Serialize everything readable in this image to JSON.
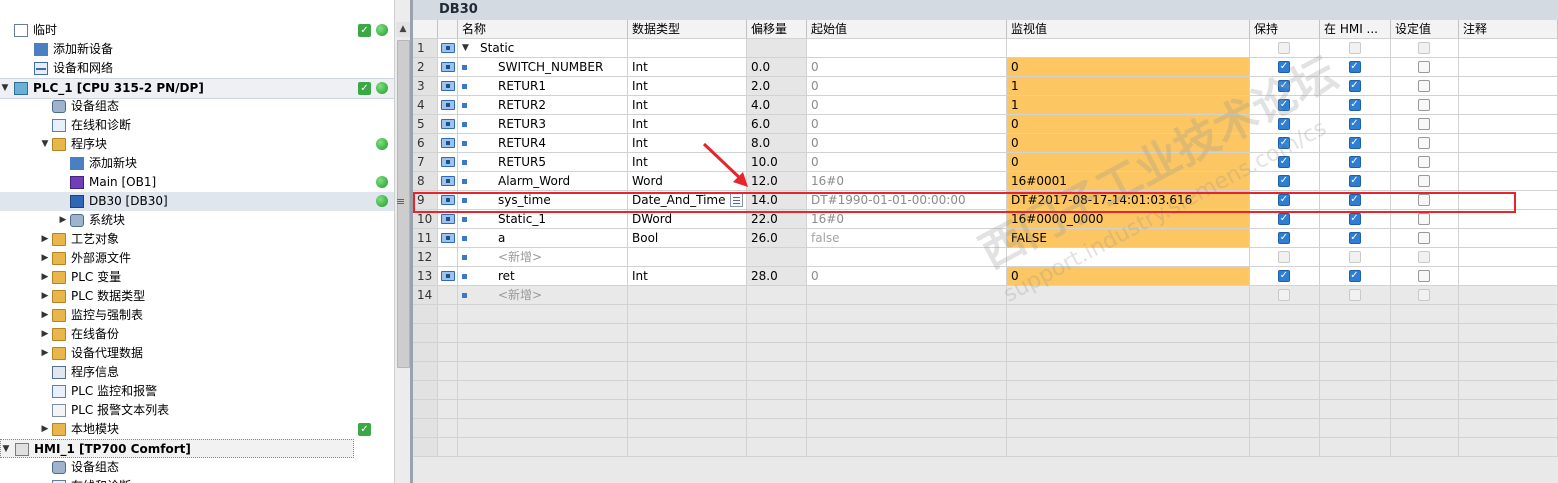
{
  "tree": {
    "items": [
      {
        "label": "临时",
        "indent": 0,
        "icon": "document-icon",
        "checkbox": true,
        "status_dot": true
      },
      {
        "label": "添加新设备",
        "indent": 1,
        "icon": "add-device-icon"
      },
      {
        "label": "设备和网络",
        "indent": 1,
        "icon": "network-icon"
      },
      {
        "label": "PLC_1 [CPU 315-2 PN/DP]",
        "indent": 0,
        "icon": "plc-icon",
        "bold": true,
        "expanded": true,
        "checkbox": true,
        "status_dot": true
      },
      {
        "label": "设备组态",
        "indent": 2,
        "icon": "device-config-icon"
      },
      {
        "label": "在线和诊断",
        "indent": 2,
        "icon": "diagnostics-icon"
      },
      {
        "label": "程序块",
        "indent": 2,
        "icon": "folder-icon",
        "expanded": true,
        "status_dot": true
      },
      {
        "label": "添加新块",
        "indent": 3,
        "icon": "add-block-icon"
      },
      {
        "label": "Main [OB1]",
        "indent": 3,
        "icon": "ob-block-icon",
        "status_dot": true
      },
      {
        "label": "DB30 [DB30]",
        "indent": 3,
        "icon": "db-block-icon",
        "status_dot": true,
        "selected": true
      },
      {
        "label": "系统块",
        "indent": 3,
        "icon": "system-block-icon",
        "collapsed": true
      },
      {
        "label": "工艺对象",
        "indent": 2,
        "icon": "folder-icon",
        "collapsed": true
      },
      {
        "label": "外部源文件",
        "indent": 2,
        "icon": "folder-icon",
        "collapsed": true
      },
      {
        "label": "PLC 变量",
        "indent": 2,
        "icon": "folder-icon",
        "collapsed": true
      },
      {
        "label": "PLC 数据类型",
        "indent": 2,
        "icon": "folder-icon",
        "collapsed": true
      },
      {
        "label": "监控与强制表",
        "indent": 2,
        "icon": "folder-icon",
        "collapsed": true
      },
      {
        "label": "在线备份",
        "indent": 2,
        "icon": "folder-icon",
        "collapsed": true
      },
      {
        "label": "设备代理数据",
        "indent": 2,
        "icon": "folder-icon",
        "collapsed": true
      },
      {
        "label": "程序信息",
        "indent": 2,
        "icon": "program-info-icon"
      },
      {
        "label": "PLC 监控和报警",
        "indent": 2,
        "icon": "alarm-icon"
      },
      {
        "label": "PLC 报警文本列表",
        "indent": 2,
        "icon": "text-list-icon"
      },
      {
        "label": "本地模块",
        "indent": 2,
        "icon": "folder-icon",
        "collapsed": true,
        "checkbox": true
      },
      {
        "label": "HMI_1 [TP700 Comfort]",
        "indent": 0,
        "icon": "hmi-icon",
        "bold": true,
        "expanded": true,
        "device_dotted": true
      },
      {
        "label": "设备组态",
        "indent": 2,
        "icon": "device-config-icon"
      },
      {
        "label": "在线和诊断",
        "indent": 2,
        "icon": "diagnostics-icon"
      }
    ]
  },
  "db": {
    "title": "DB30",
    "columns": [
      "名称",
      "数据类型",
      "偏移量",
      "起始值",
      "监视值",
      "保持",
      "在 HMI ...",
      "设定值",
      "注释"
    ],
    "rows": [
      {
        "num": "1",
        "name": "Static",
        "type": "",
        "offset": "",
        "start": "",
        "monitor": "",
        "retain": false,
        "hmi": false,
        "setpoint": false,
        "is_section": true
      },
      {
        "num": "2",
        "name": "SWITCH_NUMBER",
        "type": "Int",
        "offset": "0.0",
        "start": "0",
        "monitor": "0",
        "retain": true,
        "hmi": true,
        "setpoint": false
      },
      {
        "num": "3",
        "name": "RETUR1",
        "type": "Int",
        "offset": "2.0",
        "start": "0",
        "monitor": "1",
        "retain": true,
        "hmi": true,
        "setpoint": false
      },
      {
        "num": "4",
        "name": "RETUR2",
        "type": "Int",
        "offset": "4.0",
        "start": "0",
        "monitor": "1",
        "retain": true,
        "hmi": true,
        "setpoint": false
      },
      {
        "num": "5",
        "name": "RETUR3",
        "type": "Int",
        "offset": "6.0",
        "start": "0",
        "monitor": "0",
        "retain": true,
        "hmi": true,
        "setpoint": false
      },
      {
        "num": "6",
        "name": "RETUR4",
        "type": "Int",
        "offset": "8.0",
        "start": "0",
        "monitor": "0",
        "retain": true,
        "hmi": true,
        "setpoint": false
      },
      {
        "num": "7",
        "name": "RETUR5",
        "type": "Int",
        "offset": "10.0",
        "start": "0",
        "monitor": "0",
        "retain": true,
        "hmi": true,
        "setpoint": false
      },
      {
        "num": "8",
        "name": "Alarm_Word",
        "type": "Word",
        "offset": "12.0",
        "start": "16#0",
        "monitor": "16#0001",
        "retain": true,
        "hmi": true,
        "setpoint": false
      },
      {
        "num": "9",
        "name": "sys_time",
        "type": "Date_And_Time",
        "offset": "14.0",
        "start": "DT#1990-01-01-00:00:00",
        "monitor": "DT#2017-08-17-14:01:03.616",
        "retain": true,
        "hmi": true,
        "setpoint": false,
        "highlighted": true
      },
      {
        "num": "10",
        "name": "Static_1",
        "type": "DWord",
        "offset": "22.0",
        "start": "16#0",
        "monitor": "16#0000_0000",
        "retain": true,
        "hmi": true,
        "setpoint": false
      },
      {
        "num": "11",
        "name": "a",
        "type": "Bool",
        "offset": "26.0",
        "start": "false",
        "monitor": "FALSE",
        "retain": true,
        "hmi": true,
        "setpoint": false
      },
      {
        "num": "12",
        "name": "<新增>",
        "type": "",
        "offset": "",
        "start": "",
        "monitor": "",
        "retain": false,
        "hmi": false,
        "setpoint": false,
        "is_add": true
      },
      {
        "num": "13",
        "name": "ret",
        "type": "Int",
        "offset": "28.0",
        "start": "0",
        "monitor": "0",
        "retain": true,
        "hmi": true,
        "setpoint": false
      },
      {
        "num": "14",
        "name": "<新增>",
        "type": "",
        "offset": "",
        "start": "",
        "monitor": "",
        "retain": false,
        "hmi": false,
        "setpoint": false,
        "is_add": true,
        "outer": true
      }
    ]
  },
  "watermark": {
    "text": "西门子工业技术论坛",
    "url": "support.industry.siemens.com/cs"
  },
  "colors": {
    "monitor_bg": "#fcc662",
    "highlight_border": "#e8242c",
    "checkbox_on": "#2d7fd6",
    "status_green": "#3aa845"
  }
}
